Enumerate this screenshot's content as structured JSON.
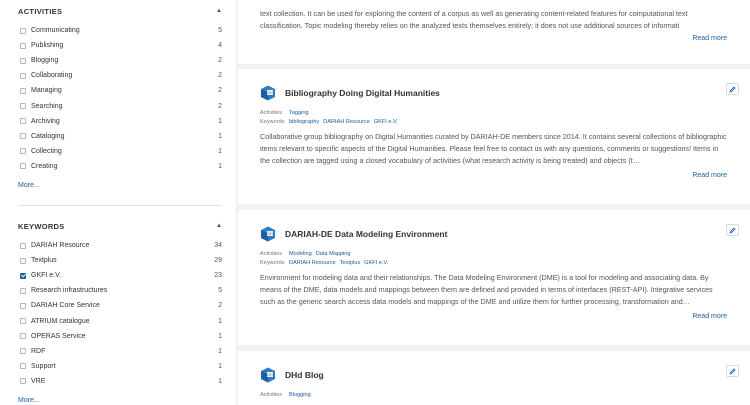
{
  "sidebar": {
    "activities": {
      "title": "ACTIVITIES",
      "items": [
        {
          "label": "Communicating",
          "count": "5",
          "checked": false
        },
        {
          "label": "Publishing",
          "count": "4",
          "checked": false
        },
        {
          "label": "Blogging",
          "count": "2",
          "checked": false
        },
        {
          "label": "Collaborating",
          "count": "2",
          "checked": false
        },
        {
          "label": "Managing",
          "count": "2",
          "checked": false
        },
        {
          "label": "Searching",
          "count": "2",
          "checked": false
        },
        {
          "label": "Archiving",
          "count": "1",
          "checked": false
        },
        {
          "label": "Cataloging",
          "count": "1",
          "checked": false
        },
        {
          "label": "Collecting",
          "count": "1",
          "checked": false
        },
        {
          "label": "Creating",
          "count": "1",
          "checked": false
        }
      ],
      "more": "More..."
    },
    "keywords": {
      "title": "KEYWORDS",
      "items": [
        {
          "label": "DARIAH Resource",
          "count": "34",
          "checked": false
        },
        {
          "label": "Textplus",
          "count": "29",
          "checked": false
        },
        {
          "label": "GKFI e.V.",
          "count": "23",
          "checked": true
        },
        {
          "label": "Research infrastructures",
          "count": "5",
          "checked": false
        },
        {
          "label": "DARIAH Core Service",
          "count": "2",
          "checked": false
        },
        {
          "label": "ATRIUM catalogue",
          "count": "1",
          "checked": false
        },
        {
          "label": "OPERAS Service",
          "count": "1",
          "checked": false
        },
        {
          "label": "RDF",
          "count": "1",
          "checked": false
        },
        {
          "label": "Support",
          "count": "1",
          "checked": false
        },
        {
          "label": "VRE",
          "count": "1",
          "checked": false
        }
      ],
      "more": "More..."
    }
  },
  "top_card": {
    "lines": [
      "text collection. It can be used for exploring the content of a corpus as well as generating content-related features for computational text",
      "classification. Topic modeling thereby relies on the analyzed texts themselves entirely; it does not use additional sources of informati"
    ],
    "read_more": "Read more"
  },
  "meta_labels": {
    "activities": "Activities",
    "keywords": "Keywords"
  },
  "cards": [
    {
      "title": "Bibliography Doing Digital Humanities",
      "activities": [
        "Tagging"
      ],
      "keywords": [
        "bibliography",
        "DARIAH Resource",
        "GKFI e.V."
      ],
      "description": "Collaborative group bibliography on Digital Humanities curated by DARIAH-DE members since 2014. It contains several collections of bibliographic items relevant to specific aspects of the Digital Humanities. Please feel free to contact us with any questions, comments or suggestions! Items in the collection are tagged using a closed vocabulary of activities (what research activity is being treated) and objects (t…",
      "read_more": "Read more"
    },
    {
      "title": "DARIAH-DE Data Modeling Environment",
      "activities": [
        "Modeling",
        "Data Mapping"
      ],
      "keywords": [
        "DARIAH Resource",
        "Textplus",
        "GKFI e.V."
      ],
      "description": "Environment for modeling data and their relationships. The Data Modeling Environment (DME) is a tool for modeling and associating data. By means of the DME, data models and mappings between them are defined and provided in terms of interfaces (REST-API). Integrative services such as the generic search access data models and mappings of the DME and utilize them for further processing, transformation and…",
      "read_more": "Read more"
    },
    {
      "title": "DHd Blog",
      "activities": [
        "Blogging"
      ],
      "keywords": [],
      "description": "",
      "read_more": ""
    }
  ],
  "colors": {
    "accent": "#1a5fa0",
    "logo_blue": "#2e7ec2",
    "background": "#f1f1f1"
  },
  "icons": {
    "card_logo": "dh-logo-icon",
    "edit": "pencil-icon",
    "collapse": "caret-up-icon"
  }
}
